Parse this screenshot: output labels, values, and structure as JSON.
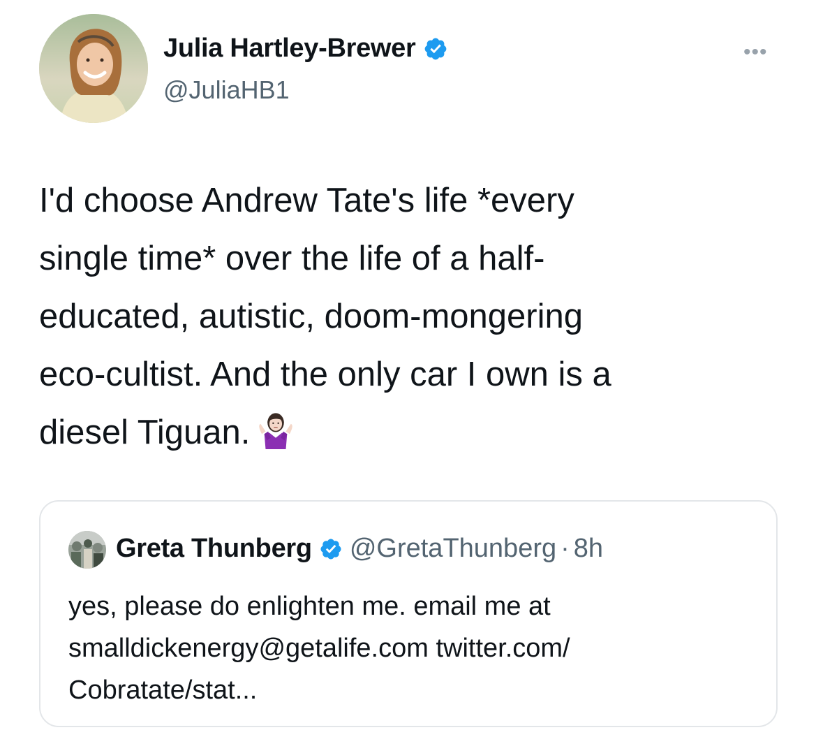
{
  "tweet": {
    "author_name": "Julia Hartley-Brewer",
    "author_handle": "@JuliaHB1",
    "more_label": "•••",
    "text_lines": [
      "I'd choose Andrew Tate's life *every",
      "single time* over the life of a half-",
      "educated, autistic, doom-mongering",
      "eco-cultist. And the only car I own is a",
      "diesel Tiguan."
    ],
    "emoji": "woman-shrugging-emoji"
  },
  "quoted": {
    "author_name": "Greta Thunberg",
    "author_handle": "@GretaThunberg",
    "separator": "·",
    "time": "8h",
    "text_lines": [
      "yes, please do enlighten me. email me at",
      "smalldickenergy@getalife.com twitter.com/",
      "Cobratate/stat..."
    ]
  },
  "colors": {
    "verified_blue": "#1d9bf0",
    "secondary_text": "#536471",
    "border": "#e3e6e9"
  }
}
